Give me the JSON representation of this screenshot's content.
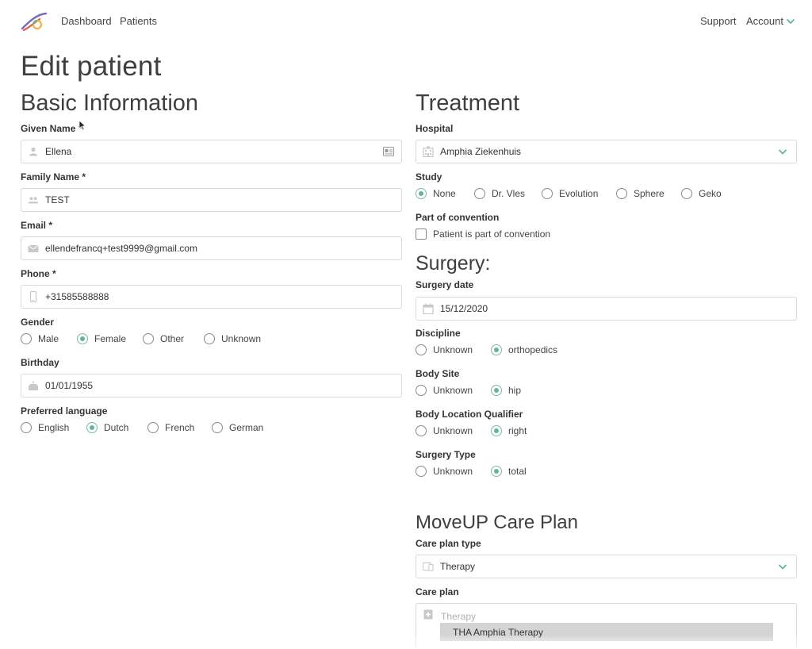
{
  "nav": {
    "links": [
      "Dashboard",
      "Patients"
    ],
    "support": "Support",
    "account": "Account"
  },
  "page_title": "Edit patient",
  "basic": {
    "title": "Basic Information",
    "given_name": {
      "label": "Given Name *",
      "value": "Ellena"
    },
    "family_name": {
      "label": "Family Name *",
      "value": "TEST"
    },
    "email": {
      "label": "Email *",
      "value": "ellendefrancq+test9999@gmail.com"
    },
    "phone": {
      "label": "Phone *",
      "value": "+31585588888"
    },
    "gender": {
      "label": "Gender",
      "options": [
        "Male",
        "Female",
        "Other",
        "Unknown"
      ],
      "selected": "Female"
    },
    "birthday": {
      "label": "Birthday",
      "value": "01/01/1955"
    },
    "language": {
      "label": "Preferred language",
      "options": [
        "English",
        "Dutch",
        "French",
        "German"
      ],
      "selected": "Dutch"
    }
  },
  "treatment": {
    "title": "Treatment",
    "hospital": {
      "label": "Hospital",
      "value": "Amphia Ziekenhuis"
    },
    "study": {
      "label": "Study",
      "options": [
        "None",
        "Dr. Vles",
        "Evolution",
        "Sphere",
        "Geko"
      ],
      "selected": "None"
    },
    "convention": {
      "label": "Part of convention",
      "checkbox_label": "Patient is part of convention",
      "checked": false
    }
  },
  "surgery": {
    "title": "Surgery:",
    "date": {
      "label": "Surgery date",
      "value": "15/12/2020"
    },
    "discipline": {
      "label": "Discipline",
      "options": [
        "Unknown",
        "orthopedics"
      ],
      "selected": "orthopedics"
    },
    "body_site": {
      "label": "Body Site",
      "options": [
        "Unknown",
        "hip"
      ],
      "selected": "hip"
    },
    "qualifier": {
      "label": "Body Location Qualifier",
      "options": [
        "Unknown",
        "right"
      ],
      "selected": "right"
    },
    "surgery_type": {
      "label": "Surgery Type",
      "options": [
        "Unknown",
        "total"
      ],
      "selected": "total"
    }
  },
  "careplan": {
    "title": "MoveUP Care Plan",
    "type": {
      "label": "Care plan type",
      "value": "Therapy"
    },
    "plan": {
      "label": "Care plan",
      "placeholder": "Therapy",
      "highlighted_option": "THA Amphia Therapy"
    }
  },
  "colors": {
    "accent": "#5fb79a",
    "border": "#d9d9d9"
  }
}
